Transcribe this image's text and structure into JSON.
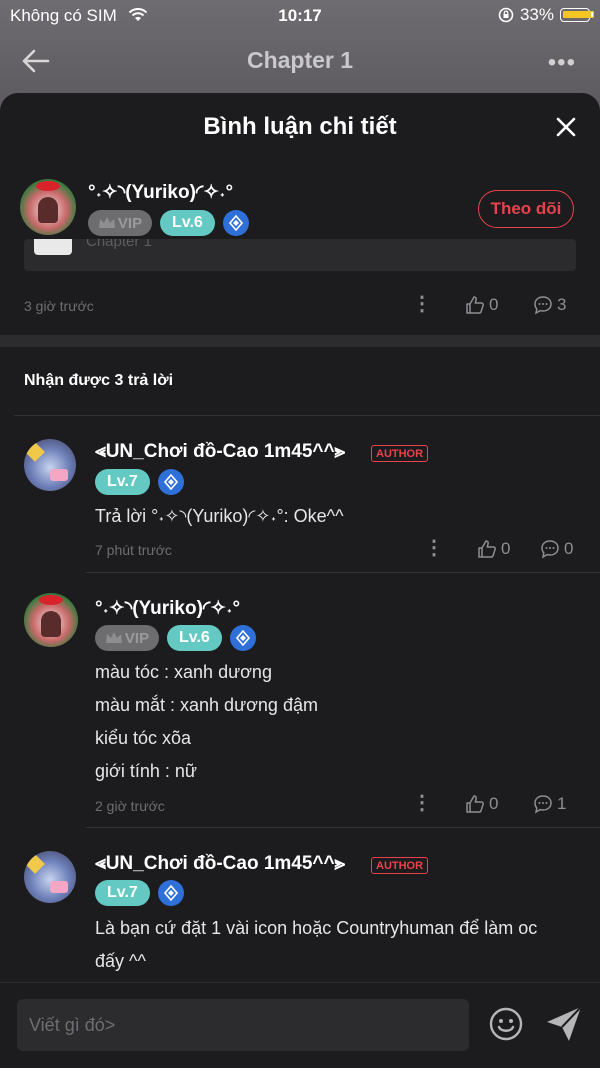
{
  "status_bar": {
    "carrier": "Không có SIM",
    "time": "10:17",
    "battery": "33%",
    "battery_level": 0.33
  },
  "nav": {
    "title": "Chapter 1"
  },
  "sheet": {
    "title": "Bình luận chi tiết"
  },
  "main_comment": {
    "name": "°˖✧◝(Yuriko)◜✧˖°",
    "vip": "VIP",
    "level": "Lv.6",
    "follow_label": "Theo dõi",
    "quote_text": "Chapter 1",
    "time": "3 giờ trước",
    "likes": "0",
    "replies": "3"
  },
  "replies_header": "Nhận được 3 trả lời",
  "replies": [
    {
      "name": "⪡UN_Chơi đồ-Cao 1m45^^⪢",
      "author": "AUTHOR",
      "level": "Lv.7",
      "lines": [
        "Trả lời °˖✧◝(Yuriko)◜✧˖°: Oke^^"
      ],
      "time": "7 phút trước",
      "likes": "0",
      "replies": "0"
    },
    {
      "name": "°˖✧◝(Yuriko)◜✧˖°",
      "vip": "VIP",
      "level": "Lv.6",
      "lines": [
        "màu tóc : xanh dương",
        "màu mắt : xanh dương đậm",
        "kiểu tóc xõa",
        "giới tính : nữ"
      ],
      "time": "2 giờ trước",
      "likes": "0",
      "replies": "1"
    },
    {
      "name": "⪡UN_Chơi đồ-Cao 1m45^^⪢",
      "author": "AUTHOR",
      "level": "Lv.7",
      "lines": [
        "Là bạn cứ đặt 1 vài icon hoặc Countryhuman để làm oc",
        "đấy ^^"
      ]
    }
  ],
  "composer": {
    "placeholder": "Viết gì đó>"
  },
  "icons": [
    "wifi-icon",
    "battery-icon",
    "lock-rotation-icon",
    "back-arrow-icon",
    "more-icon",
    "close-icon",
    "crown-icon",
    "diamond-icon",
    "like-icon",
    "comment-icon",
    "kebab-icon",
    "emoji-icon",
    "send-icon"
  ],
  "colors": {
    "accent": "#e8424d",
    "level": "#63c9c2",
    "background": "#1c1c1e",
    "diamond": "#2f6fd8"
  }
}
